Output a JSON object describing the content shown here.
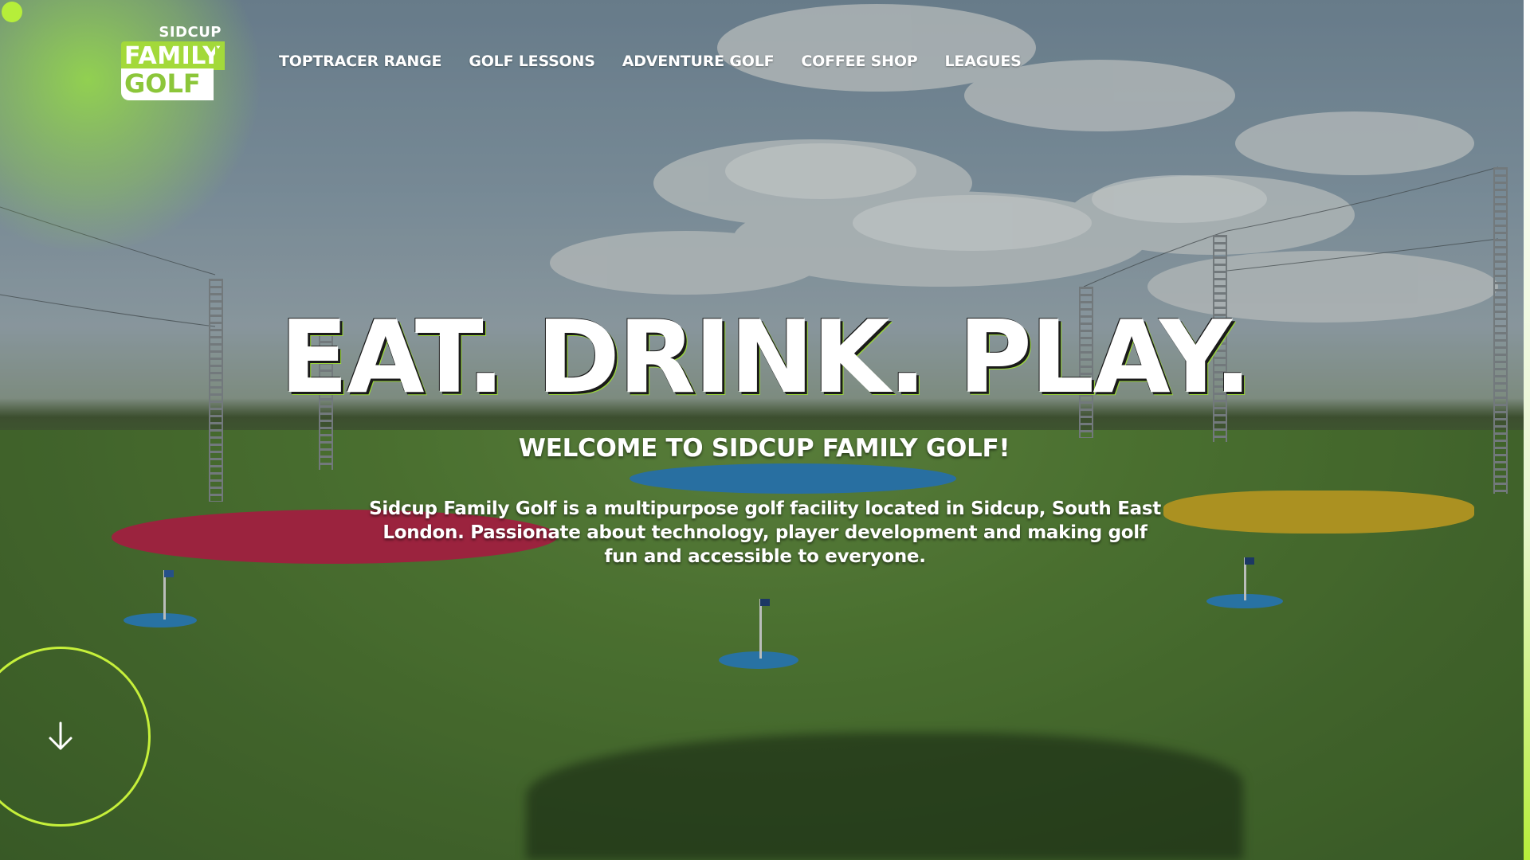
{
  "brand": {
    "logo_top": "SIDCUP",
    "logo_middle": "FAMILY",
    "logo_bottom": "GOLF",
    "accent_color": "#a3d93a",
    "accent_bright": "#c6f03a"
  },
  "nav": {
    "items": [
      {
        "label": "TOPTRACER RANGE"
      },
      {
        "label": "GOLF LESSONS"
      },
      {
        "label": "ADVENTURE GOLF"
      },
      {
        "label": "COFFEE SHOP"
      },
      {
        "label": "LEAGUES"
      }
    ]
  },
  "hero": {
    "headline": "EAT. DRINK. PLAY.",
    "subheadline": "WELCOME TO SIDCUP FAMILY GOLF!",
    "description": "Sidcup Family Golf is a multipurpose golf facility located in Sidcup, South East London. Passionate about technology, player development and making golf fun and accessible to everyone."
  },
  "scroll_button": {
    "icon": "arrow-down-icon"
  }
}
